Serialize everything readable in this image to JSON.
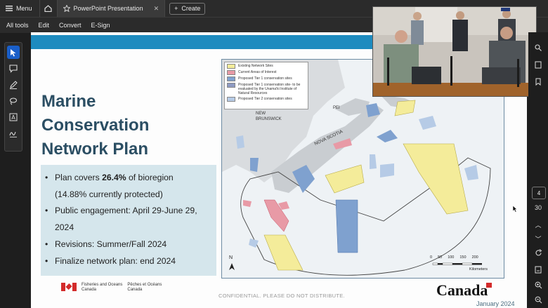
{
  "topbar": {
    "menu_label": "Menu",
    "tab_title": "PowerPoint Presentation",
    "create_label": "Create"
  },
  "toolbar": {
    "items": [
      "All tools",
      "Edit",
      "Convert",
      "E-Sign"
    ]
  },
  "slide": {
    "title_lines": [
      "Marine",
      "Conservation",
      "Network Plan"
    ],
    "bullets": {
      "b1_pre": "Plan covers ",
      "b1_bold": "26.4%",
      "b1_post": " of bioregion",
      "b1_line2": "(14.88% currently protected)",
      "b2": "Public engagement: April 29-June 29, 2024",
      "b3": "Revisions: Summer/Fall 2024",
      "b4": "Finalize network plan: end 2024"
    },
    "map": {
      "legend": [
        "Existing Network Sites",
        "Current Areas of Interest",
        "Proposed Tier 1 conservation sites",
        "Proposed Tier 1 conservation site- to be evaluated by the Unama'ki Institute of Natural Resources",
        "Proposed Tier 2 conservation sites"
      ],
      "labels": {
        "new_brunswick": "NEW\nBRUNSWICK",
        "nova_scotia": "NOVA SCOTIA",
        "pei": "PEI",
        "north": "N"
      },
      "scale_ticks": [
        "0",
        "50",
        "100",
        "150",
        "200"
      ],
      "scale_unit": "Kilometers"
    },
    "footer": {
      "dfo_en": "Fisheries and Oceans\nCanada",
      "dfo_fr": "Pêches et Océans\nCanada",
      "confidential": "CONFIDENTIAL. PLEASE DO NOT DISTRIBUTE.",
      "canada_wordmark": "Canada",
      "date": "January 2024"
    }
  },
  "right_rail": {
    "current_page": "4",
    "total_pages": "30"
  },
  "colors": {
    "slide_band": "#1d8bbf",
    "title": "#2b4e63",
    "bullet_box": "#d5e6ec",
    "existing": "#f4ec9a",
    "aoi": "#e89aa6",
    "tier1": "#7fa1cf",
    "tier1_uinr": "#8e9ac2",
    "tier2": "#b6cbe6"
  }
}
